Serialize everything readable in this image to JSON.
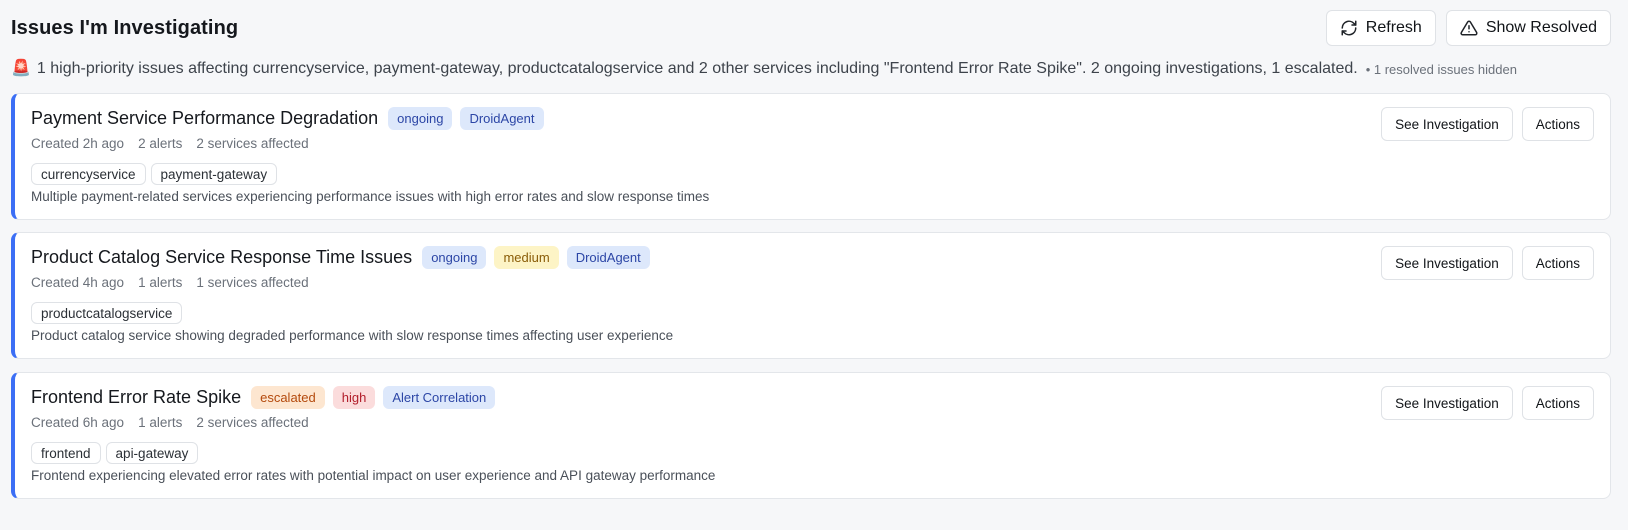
{
  "header": {
    "title": "Issues I'm Investigating",
    "refresh_label": "Refresh",
    "show_resolved_label": "Show Resolved"
  },
  "summary": {
    "icon": "alarm-siren-icon",
    "text": "1 high-priority issues affecting currencyservice, payment-gateway, productcatalogservice and 2 other services including \"Frontend Error Rate Spike\". 2 ongoing investigations, 1 escalated.",
    "hidden_note": "• 1 resolved issues hidden"
  },
  "colors": {
    "accent": "#3b6ef5",
    "badge_blue_bg": "#dde8fb",
    "badge_orange_bg": "#fde6d0",
    "badge_yellow_bg": "#fdf4c6",
    "badge_red_bg": "#fbdcdc"
  },
  "issues": [
    {
      "title": "Payment Service Performance Degradation",
      "badges": [
        {
          "label": "ongoing",
          "kind": "blue"
        },
        {
          "label": "DroidAgent",
          "kind": "blue"
        }
      ],
      "created": "Created 2h ago",
      "alerts": "2 alerts",
      "services_affected": "2 services affected",
      "services": [
        "currencyservice",
        "payment-gateway"
      ],
      "description": "Multiple payment-related services experiencing performance issues with high error rates and slow response times",
      "see_label": "See Investigation",
      "actions_label": "Actions"
    },
    {
      "title": "Product Catalog Service Response Time Issues",
      "badges": [
        {
          "label": "ongoing",
          "kind": "blue"
        },
        {
          "label": "medium",
          "kind": "yellow"
        },
        {
          "label": "DroidAgent",
          "kind": "blue"
        }
      ],
      "created": "Created 4h ago",
      "alerts": "1 alerts",
      "services_affected": "1 services affected",
      "services": [
        "productcatalogservice"
      ],
      "description": "Product catalog service showing degraded performance with slow response times affecting user experience",
      "see_label": "See Investigation",
      "actions_label": "Actions"
    },
    {
      "title": "Frontend Error Rate Spike",
      "badges": [
        {
          "label": "escalated",
          "kind": "orange"
        },
        {
          "label": "high",
          "kind": "red"
        },
        {
          "label": "Alert Correlation",
          "kind": "blue"
        }
      ],
      "created": "Created 6h ago",
      "alerts": "1 alerts",
      "services_affected": "2 services affected",
      "services": [
        "frontend",
        "api-gateway"
      ],
      "description": "Frontend experiencing elevated error rates with potential impact on user experience and API gateway performance",
      "see_label": "See Investigation",
      "actions_label": "Actions"
    }
  ]
}
